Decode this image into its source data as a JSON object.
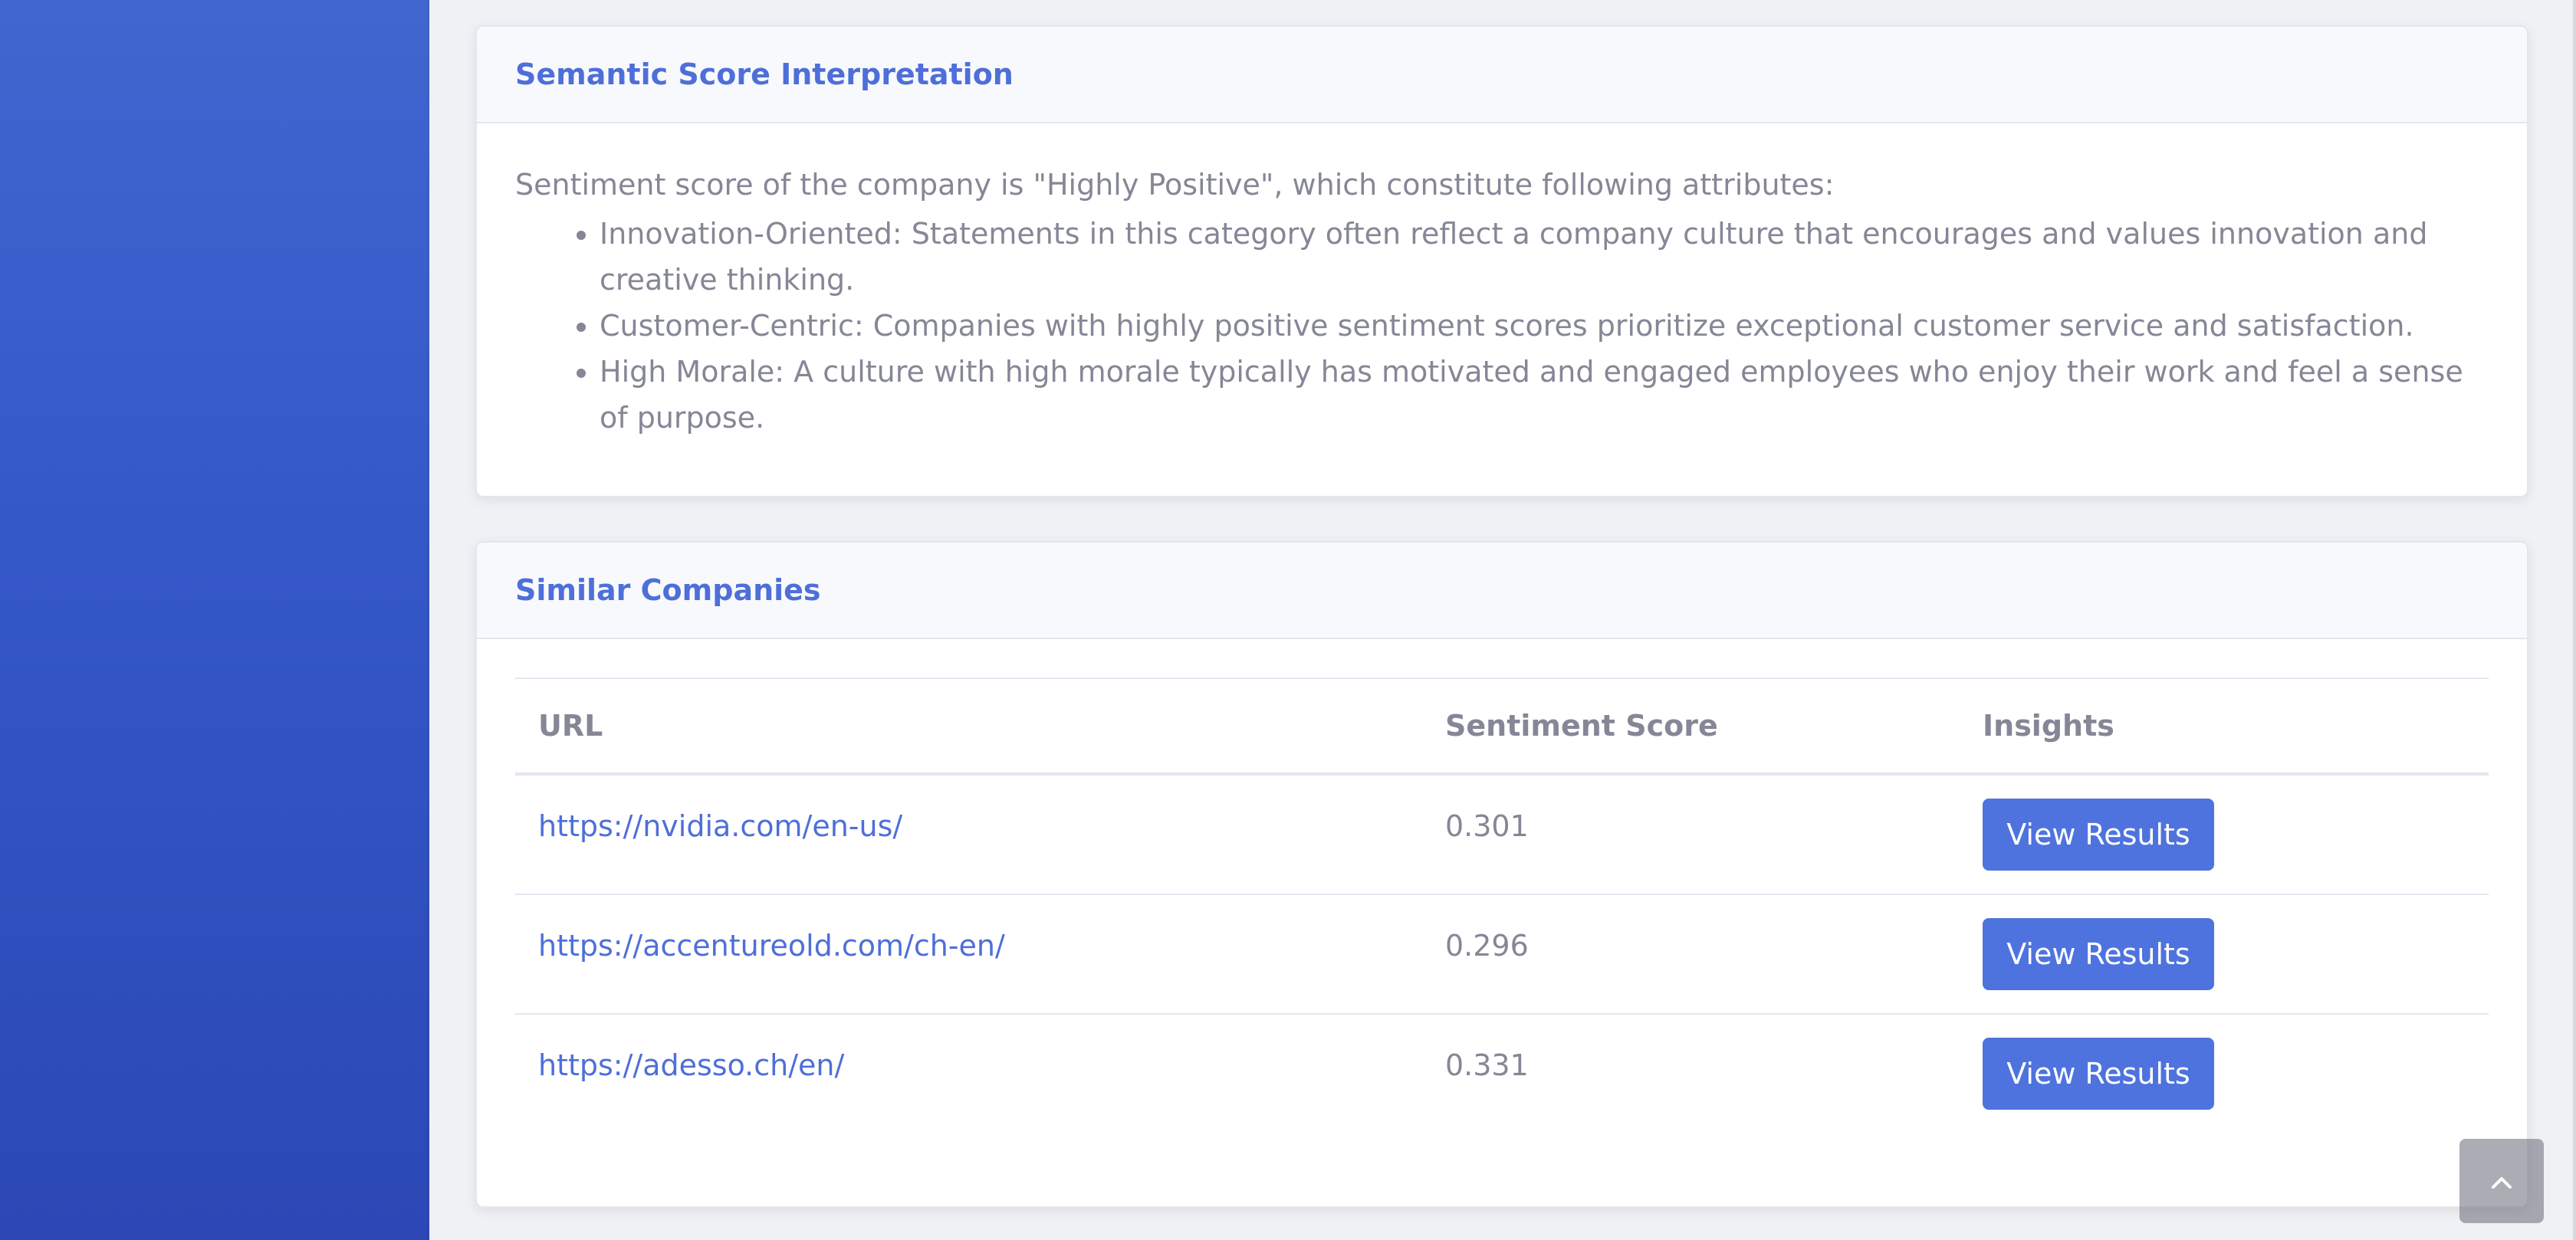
{
  "colors": {
    "sidebar_top": "#4166cf",
    "sidebar_bottom": "#2b48b5",
    "accent": "#4e73df",
    "text_muted": "#858796"
  },
  "interpretation": {
    "title": "Semantic Score Interpretation",
    "intro": "Sentiment score of the company is \"Highly Positive\", which constitute following attributes:",
    "attributes": [
      "Innovation-Oriented: Statements in this category often reflect a company culture that encourages and values innovation and creative thinking.",
      "Customer-Centric: Companies with highly positive sentiment scores prioritize exceptional customer service and satisfaction.",
      "High Morale: A culture with high morale typically has motivated and engaged employees who enjoy their work and feel a sense of purpose."
    ]
  },
  "similar": {
    "title": "Similar Companies",
    "columns": [
      "URL",
      "Sentiment Score",
      "Insights"
    ],
    "rows": [
      {
        "url": "https://nvidia.com/en-us/",
        "score": "0.301",
        "action": "View Results"
      },
      {
        "url": "https://accentureold.com/ch-en/",
        "score": "0.296",
        "action": "View Results"
      },
      {
        "url": "https://adesso.ch/en/",
        "score": "0.331",
        "action": "View Results"
      }
    ]
  },
  "scroll_top_icon": "chevron-up-icon"
}
